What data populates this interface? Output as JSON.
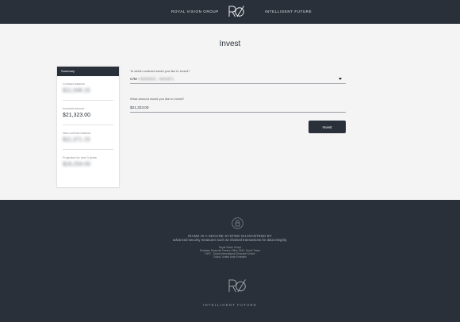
{
  "header": {
    "brand_left": "ROYAL VISION GROUP",
    "brand_right": "INTELLIGENT FUTURE",
    "logo_icon": "rvg-monogram-logo"
  },
  "page": {
    "title": "Invest"
  },
  "summary": {
    "heading": "Summary",
    "items": [
      {
        "label": "Contract balance",
        "value": "$11,048.15",
        "obscured": true
      },
      {
        "label": "Invested amount",
        "value": "$21,323.00",
        "obscured": false
      },
      {
        "label": "New contract balance",
        "value": "$11,371.15",
        "obscured": true
      },
      {
        "label": "Projection for next 3 years",
        "value": "$16,254.00",
        "obscured": true
      }
    ]
  },
  "form": {
    "contract_question": "To which contract would you like to invest?",
    "contract_prefix": "C/M -",
    "contract_value": "00000001 · 8654871",
    "amount_question": "What amount would you like to invest?",
    "amount_value": "$21,323.00",
    "submit_label": "Invest"
  },
  "footer": {
    "lock_icon": "lock-icon",
    "security_title": "IRAMS IS A SECURE SYSTEM GUARANTEED BY",
    "security_subtitle": "advanced security measures such as chained transactions for data integrity.",
    "address_lines": [
      "Royal Vision Group",
      "Emirates Financial Towers Office 2409, South Tower",
      "DIFC - Dubai International Financial Centre",
      "Dubai, United Arab Emirates"
    ],
    "tagline": "INTELLIGENT FUTURE"
  },
  "colors": {
    "dark": "#2a3039",
    "background": "#f4f4f4",
    "card": "#ffffff"
  }
}
